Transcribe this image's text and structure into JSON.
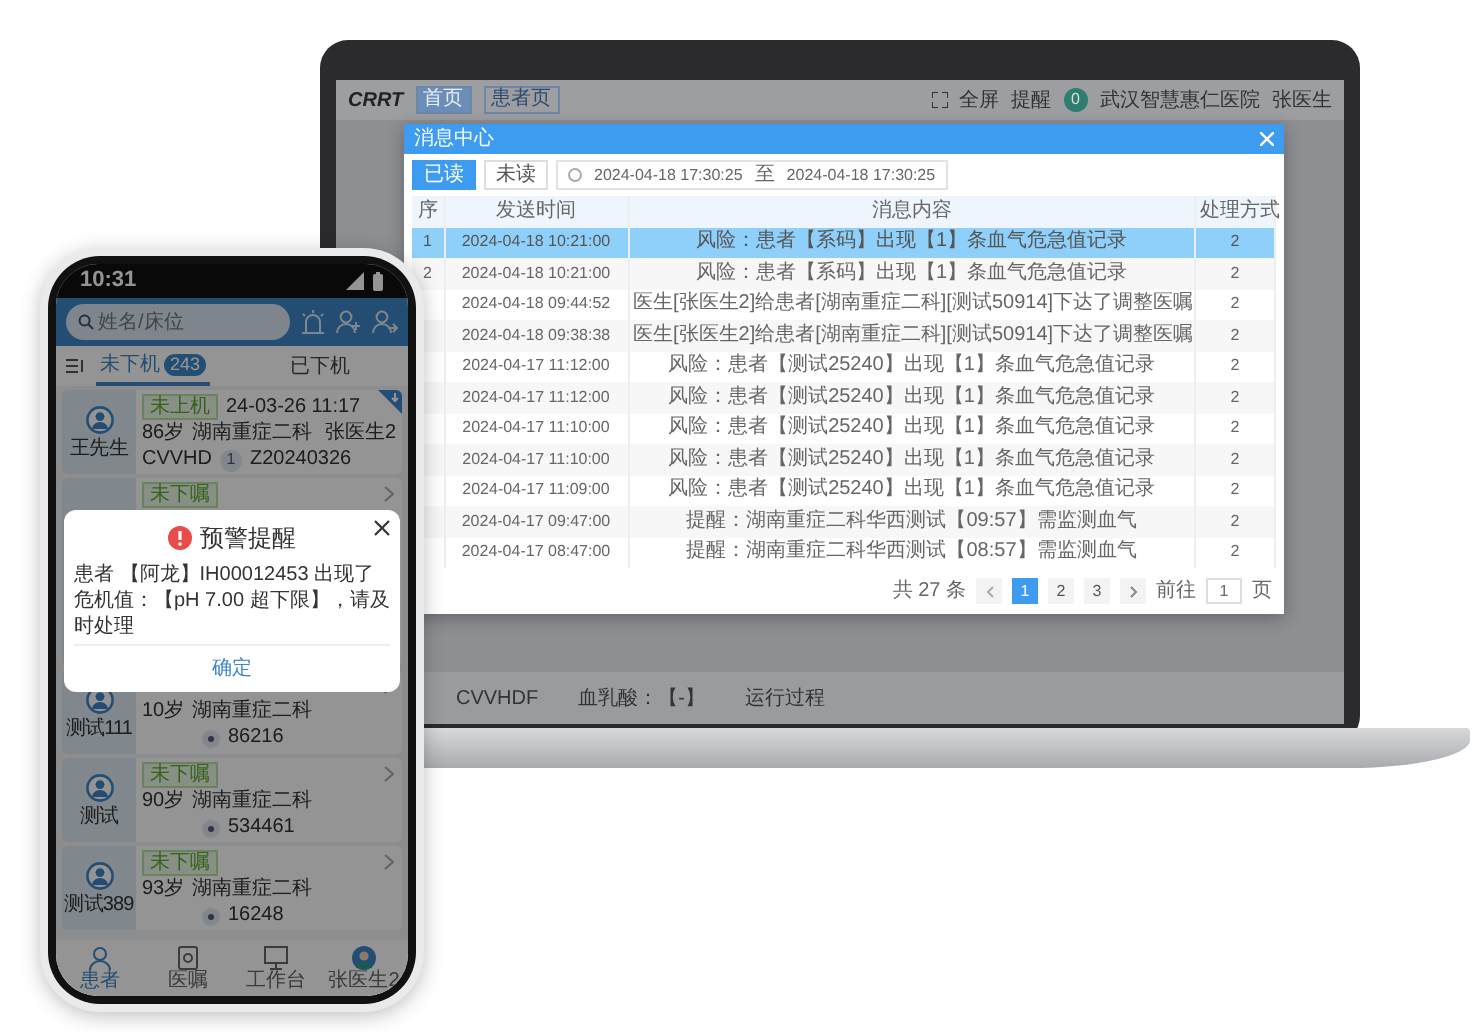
{
  "laptop": {
    "app_header": {
      "logo": "CRRT",
      "tabs": [
        {
          "label": "首页",
          "selected": true
        },
        {
          "label": "患者页",
          "selected": false
        }
      ],
      "fullscreen": "全屏",
      "reminder": "提醒",
      "reminder_count": "0",
      "hospital": "武汉智慧惠仁医院",
      "user": "张医生"
    },
    "dialog": {
      "title": "消息中心",
      "filters": [
        {
          "label": "已读",
          "selected": true
        },
        {
          "label": "未读",
          "selected": false
        }
      ],
      "date_from": "2024-04-18 17:30:25",
      "date_sep": "至",
      "date_to": "2024-04-18 17:30:25",
      "columns": [
        "序",
        "发送时间",
        "消息内容",
        "处理方式"
      ],
      "rows": [
        {
          "seq": "1",
          "time": "2024-04-18 10:21:00",
          "message": "风险：患者【系码】出现【1】条血气危急值记录",
          "action": "2",
          "selected": true
        },
        {
          "seq": "2",
          "time": "2024-04-18 10:21:00",
          "message": "风险：患者【系码】出现【1】条血气危急值记录",
          "action": "2",
          "selected": false
        },
        {
          "time": "2024-04-18 09:44:52",
          "message": "医生[张医生2]给患者[湖南重症二科][测试50914]下达了调整医嘱",
          "action": "2",
          "selected": false
        },
        {
          "time": "2024-04-18 09:38:38",
          "message": "医生[张医生2]给患者[湖南重症二科][测试50914]下达了调整医嘱",
          "action": "2",
          "selected": false
        },
        {
          "time": "2024-04-17 11:12:00",
          "message": "风险：患者【测试25240】出现【1】条血气危急值记录",
          "action": "2",
          "selected": false
        },
        {
          "time": "2024-04-17 11:12:00",
          "message": "风险：患者【测试25240】出现【1】条血气危急值记录",
          "action": "2",
          "selected": false
        },
        {
          "time": "2024-04-17 11:10:00",
          "message": "风险：患者【测试25240】出现【1】条血气危急值记录",
          "action": "2",
          "selected": false
        },
        {
          "time": "2024-04-17 11:10:00",
          "message": "风险：患者【测试25240】出现【1】条血气危急值记录",
          "action": "2",
          "selected": false
        },
        {
          "time": "2024-04-17 11:09:00",
          "message": "风险：患者【测试25240】出现【1】条血气危急值记录",
          "action": "2",
          "selected": false
        },
        {
          "time": "2024-04-17 09:47:00",
          "message": "提醒：湖南重症二科华西测试【09:57】需监测血气",
          "action": "2",
          "selected": false
        },
        {
          "time": "2024-04-17 08:47:00",
          "message": "提醒：湖南重症二科华西测试【08:57】需监测血气",
          "action": "2",
          "selected": false
        }
      ],
      "pagination": {
        "total": "共 27 条",
        "pages": [
          {
            "label": "1",
            "selected": true
          },
          {
            "label": "2",
            "selected": false
          },
          {
            "label": "3",
            "selected": false
          }
        ],
        "goto": "前往",
        "goto_value": "1",
        "page_unit": "页"
      }
    },
    "background_row": [
      "CVVHDF",
      "血乳酸：【-】",
      "运行过程"
    ]
  },
  "phone": {
    "time": "10:31",
    "search": {
      "placeholder": "姓名/床位"
    },
    "tabs": [
      {
        "label": "未下机",
        "badge": "243",
        "selected": true
      },
      {
        "label": "已下机",
        "selected": false
      }
    ],
    "patients": [
      {
        "name": "王先生",
        "tag": "未上机",
        "time": "24-03-26 11:17",
        "age": "86岁",
        "dept": "湖南重症二科",
        "doctor": "张医生2",
        "mode": "CVVHD",
        "count": "1",
        "code": "Z20240326",
        "flagged": true
      },
      {
        "tag": "未下嘱",
        "flagged": false
      },
      {
        "name": "测试111",
        "age": "10岁",
        "dept": "湖南重症二科",
        "code": "86216",
        "flagged": false
      },
      {
        "name": "测试",
        "tag": "未下嘱",
        "age": "90岁",
        "dept": "湖南重症二科",
        "code": "534461",
        "flagged": false
      },
      {
        "name": "测试389",
        "tag": "未下嘱",
        "age": "93岁",
        "dept": "湖南重症二科",
        "code": "16248",
        "flagged": false
      }
    ],
    "nav": [
      {
        "label": "患者",
        "kind": "patient",
        "selected": true
      },
      {
        "label": "医嘱",
        "kind": "order",
        "selected": false
      },
      {
        "label": "工作台",
        "kind": "desk",
        "selected": false
      },
      {
        "label": "张医生2",
        "kind": "avatar",
        "selected": false
      }
    ],
    "alert": {
      "title": "预警提醒",
      "message": "患者 【阿龙】IH00012453 出现了危机值：【pH 7.00 超下限】，请及时处理",
      "confirm": "确定"
    }
  }
}
